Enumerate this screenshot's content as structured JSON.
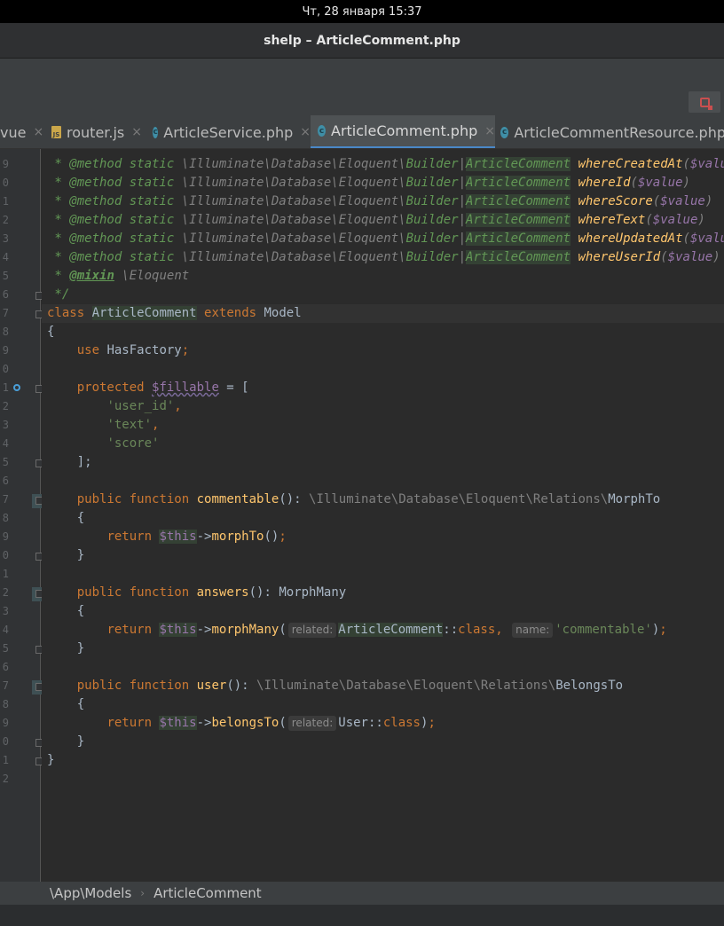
{
  "system_bar": {
    "datetime": "Чт, 28 января  15:37"
  },
  "window": {
    "title": "shelp – ArticleComment.php"
  },
  "tabs": [
    {
      "label": "vue",
      "icon": "vue-file-icon",
      "active": false
    },
    {
      "label": "router.js",
      "icon": "js-file-icon",
      "active": false
    },
    {
      "label": "ArticleService.php",
      "icon": "php-class-icon",
      "active": false
    },
    {
      "label": "ArticleComment.php",
      "icon": "php-class-icon",
      "active": true
    },
    {
      "label": "ArticleCommentResource.php",
      "icon": "php-class-icon",
      "active": false
    }
  ],
  "line_numbers": [
    "9",
    "0",
    "1",
    "2",
    "3",
    "4",
    "5",
    "6",
    "7",
    "8",
    "9",
    "0",
    "1",
    "2",
    "3",
    "4",
    "5",
    "6",
    "7",
    "8",
    "9",
    "0",
    "1",
    "2",
    "3",
    "4",
    "5",
    "6",
    "7",
    "8",
    "9",
    "0",
    "1",
    "2"
  ],
  "code": {
    "method_prefix": " * @method static ",
    "builder_ns": "\\Illuminate\\Database\\Eloquent\\",
    "builder": "Builder",
    "pipe": "|",
    "article_comment": "ArticleComment",
    "value_param": "$value",
    "methods": [
      "whereCreatedAt",
      "whereId",
      "whereScore",
      "whereText",
      "whereUpdatedAt",
      "whereUserId"
    ],
    "mixin_tag": "@mixin",
    "mixin_value": "\\Eloquent",
    "doc_end": " */",
    "kw_class": "class",
    "kw_extends": "extends",
    "model": "Model",
    "open_brace": "{",
    "close_brace": "}",
    "kw_use": "use",
    "has_factory": "HasFactory",
    "kw_protected": "protected",
    "fillable": "$fillable",
    "fillable_values": [
      "'user_id'",
      "'text'",
      "'score'"
    ],
    "array_close": "];",
    "kw_public": "public",
    "kw_function": "function",
    "kw_return": "return",
    "this": "$this",
    "fn_commentable": "commentable",
    "relations_ns": "\\Illuminate\\Database\\Eloquent\\Relations\\",
    "morph_to": "MorphTo",
    "call_morph_to": "morphTo",
    "fn_answers": "answers",
    "morph_many": "MorphMany",
    "call_morph_many": "morphMany",
    "hint_related": "related:",
    "hint_name": "name:",
    "commentable_str": "'commentable'",
    "kw_class_const": "class",
    "fn_user": "user",
    "belongs_to": "BelongsTo",
    "call_belongs_to": "belongsTo",
    "user_class": "User"
  },
  "breadcrumb": {
    "namespace": "\\App\\Models",
    "separator": "›",
    "class": "ArticleComment"
  },
  "colors": {
    "keyword": "#cc7832",
    "string": "#6a8759",
    "method": "#ffc66d",
    "variable": "#9876aa",
    "background": "#2b2b2b"
  }
}
